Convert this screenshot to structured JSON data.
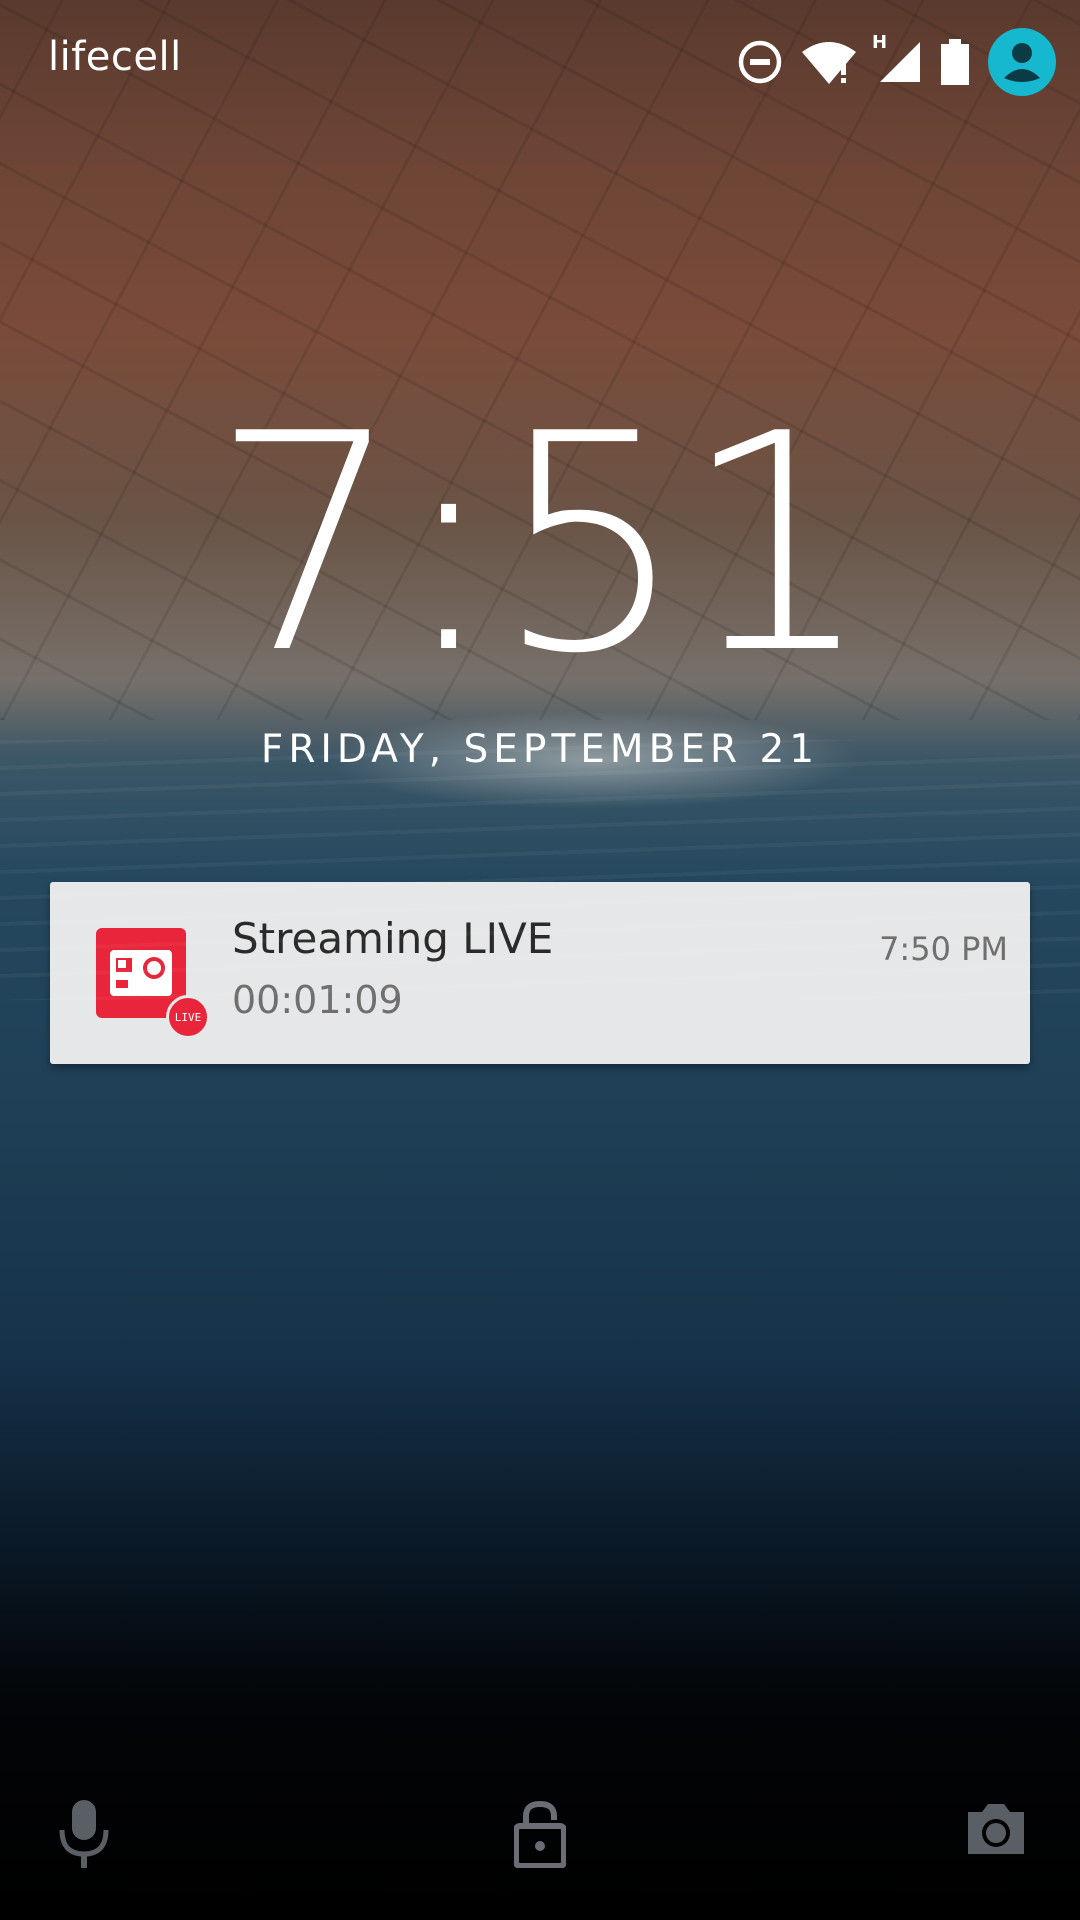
{
  "status_bar": {
    "carrier": "lifecell",
    "icons": [
      "do-not-disturb-icon",
      "wifi-alert-icon",
      "cell-signal-h-icon",
      "battery-icon",
      "user-avatar-icon"
    ],
    "network_type": "H",
    "avatar_color": "#16b8cf"
  },
  "lockscreen": {
    "time": "7:51",
    "date": "FRIDAY, SEPTEMBER 21"
  },
  "notification": {
    "app_icon": "camera-live-icon",
    "app_color": "#e8253a",
    "badge": "LIVE",
    "title": "Streaming LIVE",
    "subtitle": "00:01:09",
    "time": "7:50 PM"
  },
  "bottom_bar": {
    "left": "microphone-icon",
    "center": "lock-icon",
    "right": "camera-icon"
  }
}
